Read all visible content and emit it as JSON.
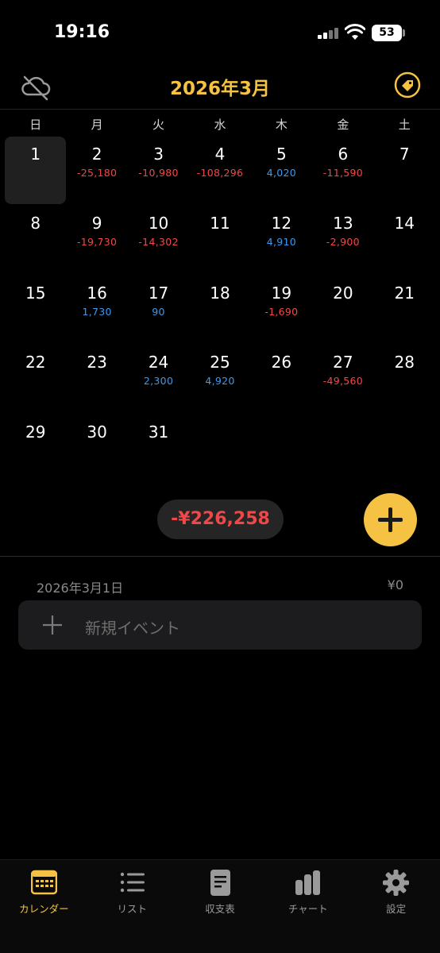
{
  "status_bar": {
    "time": "19:16",
    "battery": "53"
  },
  "header": {
    "title": "2026年3月"
  },
  "weekdays": [
    "日",
    "月",
    "火",
    "水",
    "木",
    "金",
    "土"
  ],
  "calendar": {
    "weeks": [
      [
        {
          "day": "1",
          "amount": "",
          "type": ""
        },
        {
          "day": "2",
          "amount": "-25,180",
          "type": "neg"
        },
        {
          "day": "3",
          "amount": "-10,980",
          "type": "neg"
        },
        {
          "day": "4",
          "amount": "-108,296",
          "type": "neg"
        },
        {
          "day": "5",
          "amount": "4,020",
          "type": "pos"
        },
        {
          "day": "6",
          "amount": "-11,590",
          "type": "neg"
        },
        {
          "day": "7",
          "amount": "",
          "type": ""
        }
      ],
      [
        {
          "day": "8",
          "amount": "",
          "type": ""
        },
        {
          "day": "9",
          "amount": "-19,730",
          "type": "neg"
        },
        {
          "day": "10",
          "amount": "-14,302",
          "type": "neg"
        },
        {
          "day": "11",
          "amount": "",
          "type": ""
        },
        {
          "day": "12",
          "amount": "4,910",
          "type": "pos"
        },
        {
          "day": "13",
          "amount": "-2,900",
          "type": "neg"
        },
        {
          "day": "14",
          "amount": "",
          "type": ""
        }
      ],
      [
        {
          "day": "15",
          "amount": "",
          "type": ""
        },
        {
          "day": "16",
          "amount": "1,730",
          "type": "pos"
        },
        {
          "day": "17",
          "amount": "90",
          "type": "pos"
        },
        {
          "day": "18",
          "amount": "",
          "type": ""
        },
        {
          "day": "19",
          "amount": "-1,690",
          "type": "neg"
        },
        {
          "day": "20",
          "amount": "",
          "type": ""
        },
        {
          "day": "21",
          "amount": "",
          "type": ""
        }
      ],
      [
        {
          "day": "22",
          "amount": "",
          "type": ""
        },
        {
          "day": "23",
          "amount": "",
          "type": ""
        },
        {
          "day": "24",
          "amount": "2,300",
          "type": "pos"
        },
        {
          "day": "25",
          "amount": "4,920",
          "type": "pos"
        },
        {
          "day": "26",
          "amount": "",
          "type": ""
        },
        {
          "day": "27",
          "amount": "-49,560",
          "type": "neg"
        },
        {
          "day": "28",
          "amount": "",
          "type": ""
        }
      ],
      [
        {
          "day": "29",
          "amount": "",
          "type": ""
        },
        {
          "day": "30",
          "amount": "",
          "type": ""
        },
        {
          "day": "31",
          "amount": "",
          "type": ""
        },
        {
          "day": "",
          "amount": "",
          "type": ""
        },
        {
          "day": "",
          "amount": "",
          "type": ""
        },
        {
          "day": "",
          "amount": "",
          "type": ""
        },
        {
          "day": "",
          "amount": "",
          "type": ""
        }
      ]
    ],
    "selected_day": "1"
  },
  "month_total": "-¥226,258",
  "day_detail": {
    "date": "2026年3月1日",
    "total": "¥0",
    "new_event_label": "新規イベント"
  },
  "tab_bar": {
    "tabs": [
      {
        "label": "カレンダー",
        "icon": "calendar-icon",
        "active": true
      },
      {
        "label": "リスト",
        "icon": "list-icon",
        "active": false
      },
      {
        "label": "収支表",
        "icon": "document-icon",
        "active": false
      },
      {
        "label": "チャート",
        "icon": "bar-chart-icon",
        "active": false
      },
      {
        "label": "設定",
        "icon": "gear-icon",
        "active": false
      }
    ]
  },
  "colors": {
    "accent": "#f6c243",
    "negative": "#f04848",
    "positive": "#3a9af0",
    "background": "#000000"
  }
}
